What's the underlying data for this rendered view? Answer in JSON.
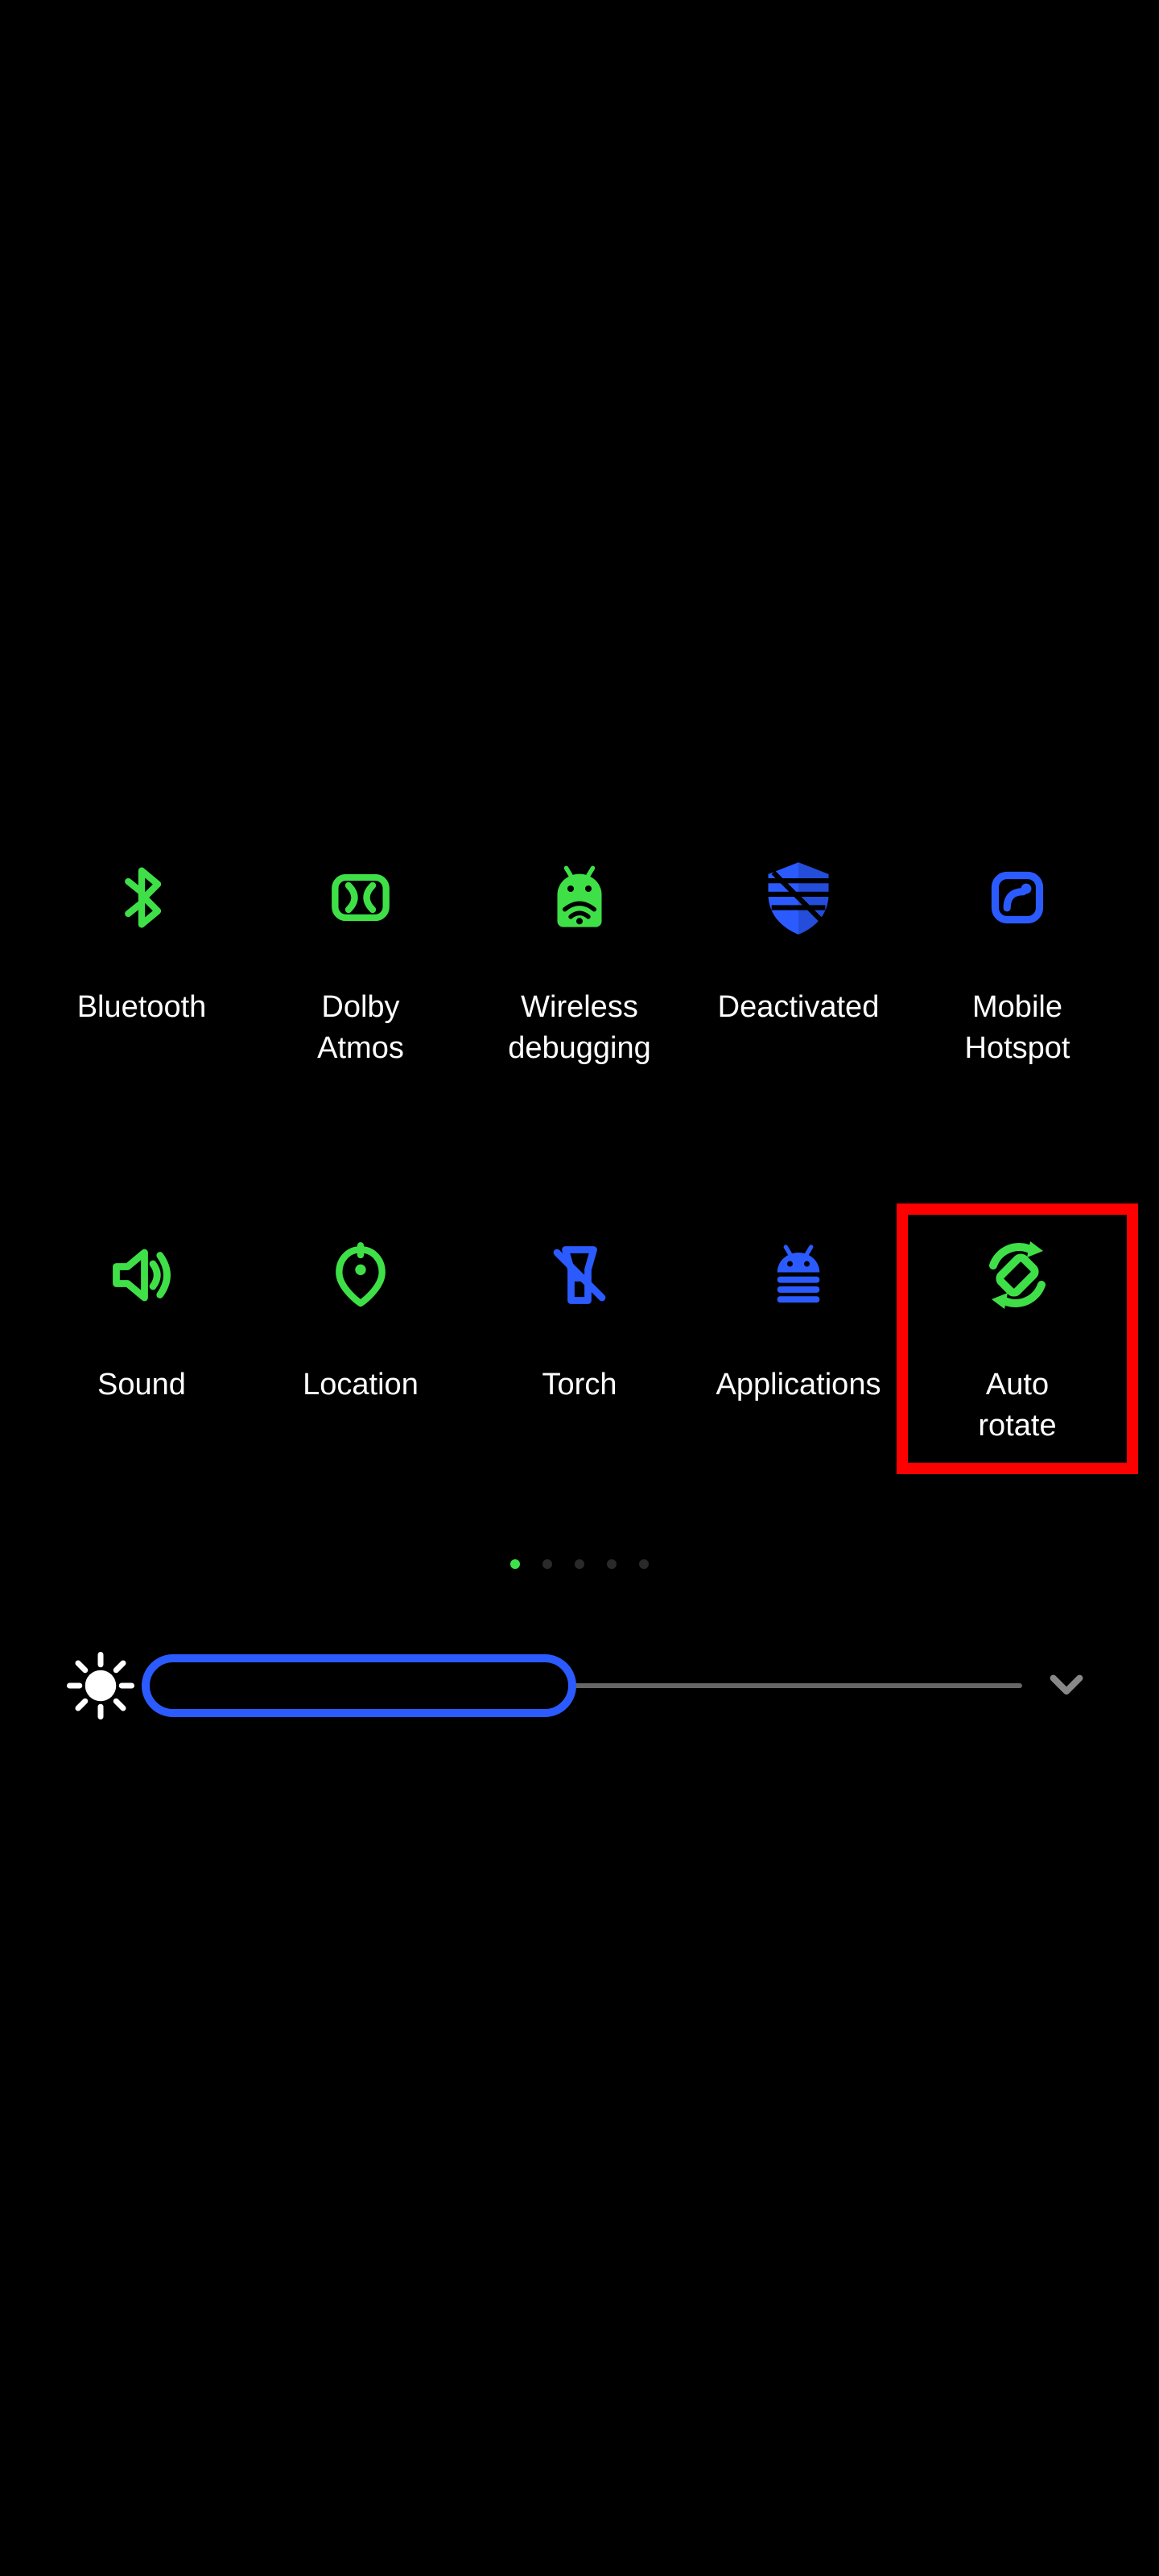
{
  "colors": {
    "active": "#3fe047",
    "inactive": "#2b5bff",
    "highlight": "#ff0000"
  },
  "tiles": [
    {
      "id": "bluetooth",
      "label": "Bluetooth",
      "icon": "bluetooth-icon",
      "state": "active",
      "highlighted": false
    },
    {
      "id": "dolby",
      "label": "Dolby\nAtmos",
      "icon": "dolby-atmos-icon",
      "state": "active",
      "highlighted": false
    },
    {
      "id": "wireless",
      "label": "Wireless\ndebugging",
      "icon": "android-wifi-icon",
      "state": "active",
      "highlighted": false
    },
    {
      "id": "deactivated",
      "label": "Deactivated",
      "icon": "shield-icon",
      "state": "inactive",
      "highlighted": false
    },
    {
      "id": "hotspot",
      "label": "Mobile\nHotspot",
      "icon": "hotspot-icon",
      "state": "inactive",
      "highlighted": false
    },
    {
      "id": "sound",
      "label": "Sound",
      "icon": "speaker-icon",
      "state": "active",
      "highlighted": false
    },
    {
      "id": "location",
      "label": "Location",
      "icon": "location-icon",
      "state": "active",
      "highlighted": false
    },
    {
      "id": "torch",
      "label": "Torch",
      "icon": "torch-icon",
      "state": "inactive",
      "highlighted": false
    },
    {
      "id": "apps",
      "label": "Applications",
      "icon": "applications-icon",
      "state": "inactive",
      "highlighted": false
    },
    {
      "id": "autorotate",
      "label": "Auto\nrotate",
      "icon": "autorotate-icon",
      "state": "active",
      "highlighted": true
    }
  ],
  "pager": {
    "count": 5,
    "active_index": 0
  },
  "brightness": {
    "percent": 50
  }
}
